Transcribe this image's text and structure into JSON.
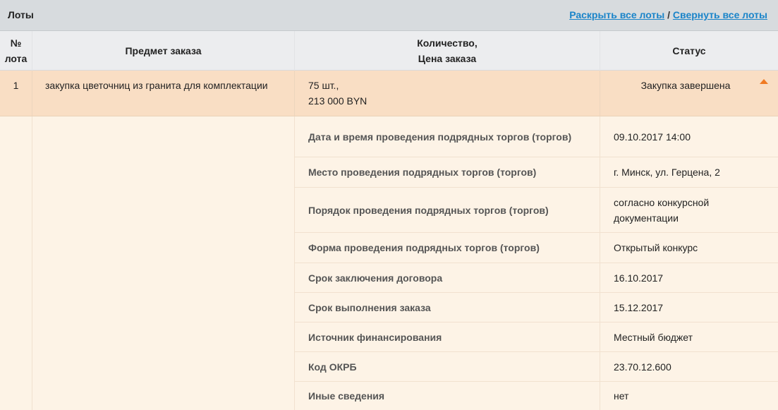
{
  "panel": {
    "title": "Лоты",
    "expand_all": "Раскрыть все лоты",
    "separator": " / ",
    "collapse_all": "Свернуть все лоты"
  },
  "columns": {
    "num_line1": "№",
    "num_line2": "лота",
    "subject": "Предмет заказа",
    "qty_line1": "Количество,",
    "qty_line2": "Цена заказа",
    "status": "Статус"
  },
  "lot": {
    "number": "1",
    "subject": "закупка цветочниц из гранита для комплектации",
    "quantity": "75 шт.,",
    "price": "213 000 BYN",
    "status": "Закупка завершена",
    "collapse_icon": "triangle-up-icon",
    "accent_color": "#f07a22"
  },
  "details": [
    {
      "label": "Дата и время проведения подрядных торгов (торгов)",
      "value": "09.10.2017 14:00"
    },
    {
      "label": "Место проведения подрядных торгов (торгов)",
      "value": "г. Минск, ул. Герцена, 2"
    },
    {
      "label": "Порядок проведения подрядных торгов (торгов)",
      "value": "согласно конкурсной документации"
    },
    {
      "label": "Форма проведения подрядных торгов (торгов)",
      "value": "Открытый конкурс"
    },
    {
      "label": "Срок заключения договора",
      "value": "16.10.2017"
    },
    {
      "label": "Срок выполнения заказа",
      "value": "15.12.2017"
    },
    {
      "label": "Источник финансирования",
      "value": "Местный бюджет"
    },
    {
      "label": "Код ОКРБ",
      "value": "23.70.12.600"
    },
    {
      "label": "Иные сведения",
      "value": "нет"
    }
  ]
}
